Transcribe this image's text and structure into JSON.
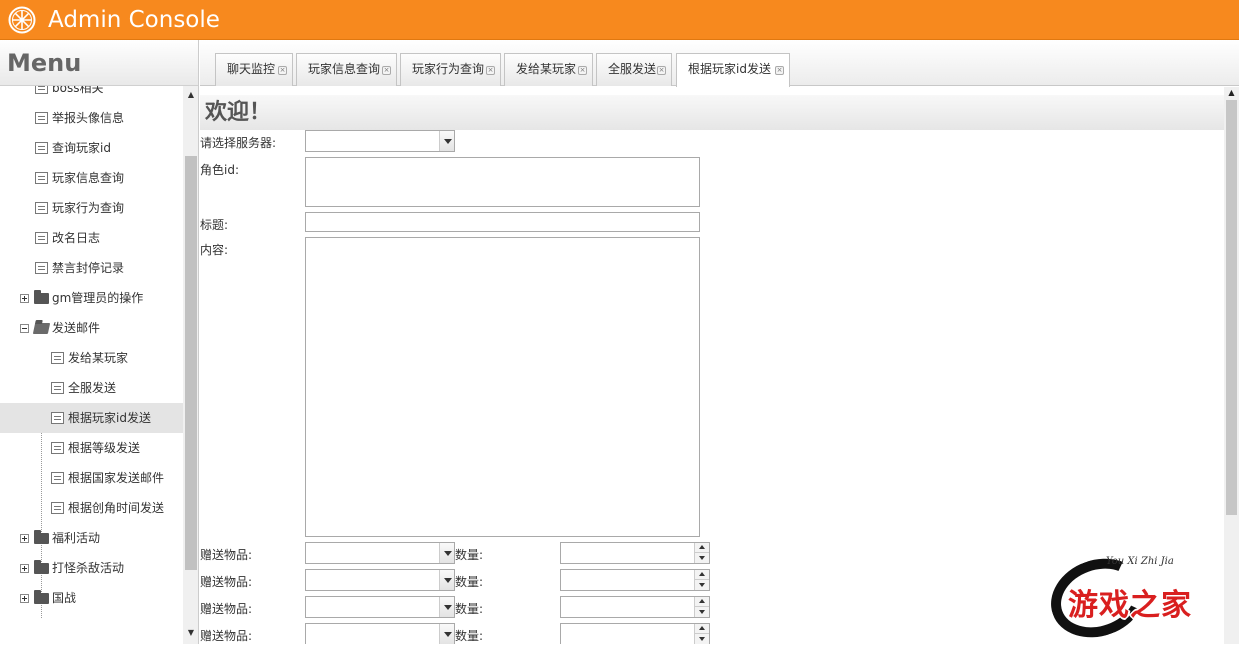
{
  "app": {
    "title": "Admin Console"
  },
  "sidebar": {
    "title": "Menu",
    "items": [
      {
        "label": "boss相关",
        "type": "leaf"
      },
      {
        "label": "举报头像信息",
        "type": "leaf"
      },
      {
        "label": "查询玩家id",
        "type": "leaf"
      },
      {
        "label": "玩家信息查询",
        "type": "leaf"
      },
      {
        "label": "玩家行为查询",
        "type": "leaf"
      },
      {
        "label": "改名日志",
        "type": "leaf"
      },
      {
        "label": "禁言封停记录",
        "type": "leaf"
      },
      {
        "label": "gm管理员的操作",
        "type": "folder-collapsed"
      },
      {
        "label": "发送邮件",
        "type": "folder-expanded"
      },
      {
        "label": "发给某玩家",
        "type": "subleaf"
      },
      {
        "label": "全服发送",
        "type": "subleaf"
      },
      {
        "label": "根据玩家id发送",
        "type": "subleaf",
        "selected": true
      },
      {
        "label": "根据等级发送",
        "type": "subleaf"
      },
      {
        "label": "根据国家发送邮件",
        "type": "subleaf"
      },
      {
        "label": "根据创角时间发送",
        "type": "subleaf"
      },
      {
        "label": "福利活动",
        "type": "folder-collapsed"
      },
      {
        "label": "打怪杀敌活动",
        "type": "folder-collapsed"
      },
      {
        "label": "国战",
        "type": "folder-collapsed"
      }
    ]
  },
  "tabs": [
    {
      "label": "聊天监控"
    },
    {
      "label": "玩家信息查询"
    },
    {
      "label": "玩家行为查询"
    },
    {
      "label": "发给某玩家"
    },
    {
      "label": "全服发送"
    },
    {
      "label": "根据玩家id发送",
      "active": true
    }
  ],
  "form": {
    "welcome": "欢迎！",
    "server_label": "请选择服务器:",
    "server_value": "",
    "role_id_label": "角色id:",
    "role_id_value": "",
    "title_label": "标题:",
    "title_value": "",
    "content_label": "内容:",
    "content_value": "",
    "gift_rows": [
      {
        "item_label": "赠送物品:",
        "qty_label": "数量:"
      },
      {
        "item_label": "赠送物品:",
        "qty_label": "数量:"
      },
      {
        "item_label": "赠送物品:",
        "qty_label": "数量:"
      },
      {
        "item_label": "赠送物品:",
        "qty_label": "数量:"
      }
    ]
  },
  "watermark": {
    "text": "游戏之家",
    "sub": "You Xi Zhi Jia"
  },
  "colors": {
    "header": "#f7891e",
    "watermark_text": "#d91f1f"
  }
}
